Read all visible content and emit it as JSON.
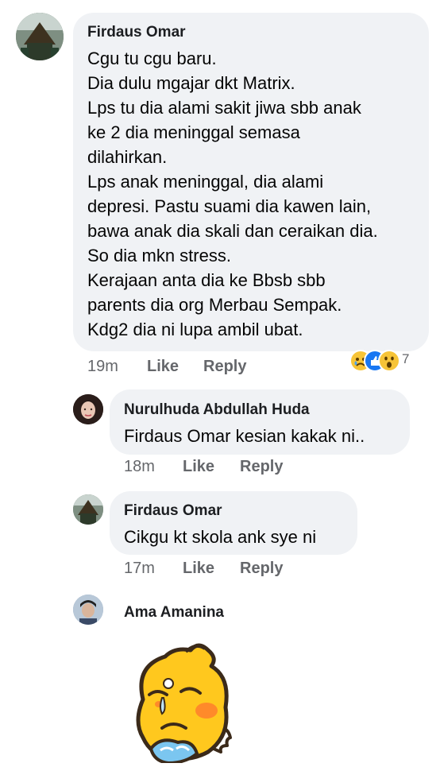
{
  "comments": [
    {
      "author": "Firdaus Omar",
      "lines": [
        "Cgu tu cgu baru.",
        "Dia dulu mgajar dkt Matrix.",
        "Lps tu dia alami sakit jiwa sbb anak",
        "ke 2 dia meninggal semasa",
        "dilahirkan.",
        "Lps anak meninggal, dia alami",
        "depresi. Pastu suami dia kawen lain,",
        "bawa anak dia skali dan ceraikan dia.",
        "So dia mkn stress.",
        "Kerajaan anta dia ke Bbsb sbb",
        "parents dia org Merbau Sempak.",
        "Kdg2 dia ni lupa ambil ubat."
      ],
      "time": "19m",
      "like": "Like",
      "reply": "Reply",
      "reaction_count": "7",
      "reaction_icons": [
        "sad-reaction-icon",
        "like-reaction-icon",
        "wow-reaction-icon"
      ]
    },
    {
      "author": "Nurulhuda Abdullah Huda",
      "text": "Firdaus Omar kesian kakak ni..",
      "time": "18m",
      "like": "Like",
      "reply": "Reply"
    },
    {
      "author": "Firdaus Omar",
      "text": "Cikgu kt skola ank sye ni",
      "time": "17m",
      "like": "Like",
      "reply": "Reply"
    },
    {
      "author": "Ama Amanina",
      "sticker": "crying-chick-sticker"
    }
  ]
}
